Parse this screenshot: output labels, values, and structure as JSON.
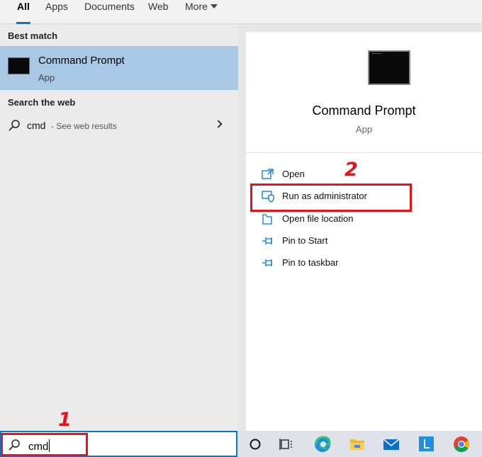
{
  "tabs": [
    {
      "label": "All",
      "active": true
    },
    {
      "label": "Apps",
      "active": false
    },
    {
      "label": "Documents",
      "active": false
    },
    {
      "label": "Web",
      "active": false
    },
    {
      "label": "More",
      "active": false
    }
  ],
  "left": {
    "best_match_header": "Best match",
    "best_match": {
      "title": "Command Prompt",
      "subtitle": "App",
      "icon": "command-prompt-icon"
    },
    "web_header": "Search the web",
    "web_result": {
      "query": "cmd",
      "suffix": " - See web results",
      "icon": "search-icon"
    }
  },
  "detail": {
    "title": "Command Prompt",
    "subtitle": "App",
    "actions": [
      {
        "label": "Open",
        "icon": "open-icon"
      },
      {
        "label": "Run as administrator",
        "icon": "shield-icon"
      },
      {
        "label": "Open file location",
        "icon": "folder-icon"
      },
      {
        "label": "Pin to Start",
        "icon": "pin-icon"
      },
      {
        "label": "Pin to taskbar",
        "icon": "pin-icon"
      }
    ]
  },
  "annotations": {
    "step1": "1",
    "step2": "2",
    "color": "#e3141b"
  },
  "search": {
    "value": "cmd"
  },
  "taskbar": {
    "items": [
      "cortana-icon",
      "task-view-icon",
      "edge-icon",
      "file-explorer-icon",
      "mail-icon",
      "l-app-icon",
      "chrome-icon"
    ]
  },
  "colors": {
    "accent": "#0078d7",
    "selection": "#a8c8e5"
  }
}
